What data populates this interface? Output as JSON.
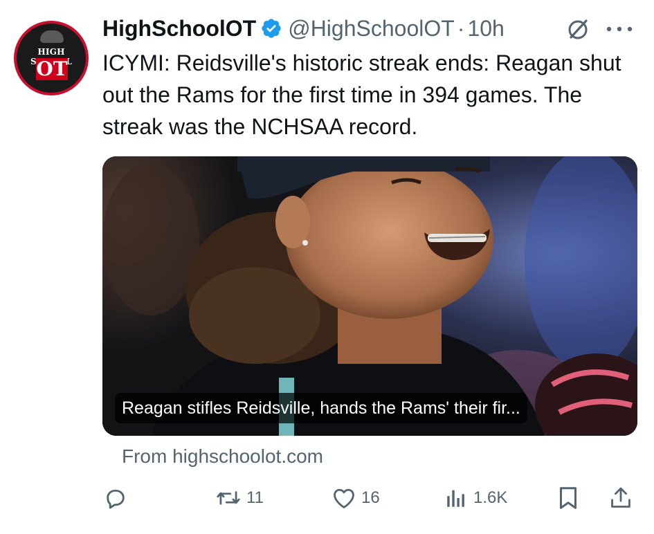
{
  "tweet": {
    "display_name": "HighSchoolOT",
    "handle": "@HighSchoolOT",
    "separator": "·",
    "time": "10h",
    "text": "ICYMI: Reidsville's historic streak ends: Reagan shut out the Rams for the first time in 394 games. The streak was the NCHSAA record.",
    "avatar": {
      "logo_top": "HIGH SCHOOL",
      "logo_bottom": "OT",
      "colors": {
        "ring": "#c8102e",
        "fill": "#d0021b"
      }
    }
  },
  "card": {
    "caption": "Reagan stifles Reidsville, hands the Rams' their fir...",
    "source": "From highschoolot.com"
  },
  "actions": {
    "reply": {
      "icon": "reply-icon",
      "count": ""
    },
    "retweet": {
      "icon": "retweet-icon",
      "count": "11"
    },
    "like": {
      "icon": "heart-icon",
      "count": "16"
    },
    "views": {
      "icon": "views-icon",
      "count": "1.6K"
    },
    "bookmark": {
      "icon": "bookmark-icon"
    },
    "share": {
      "icon": "share-icon"
    }
  },
  "colors": {
    "text": "#0f1419",
    "secondary": "#536471",
    "verified": "#1d9bf0"
  }
}
